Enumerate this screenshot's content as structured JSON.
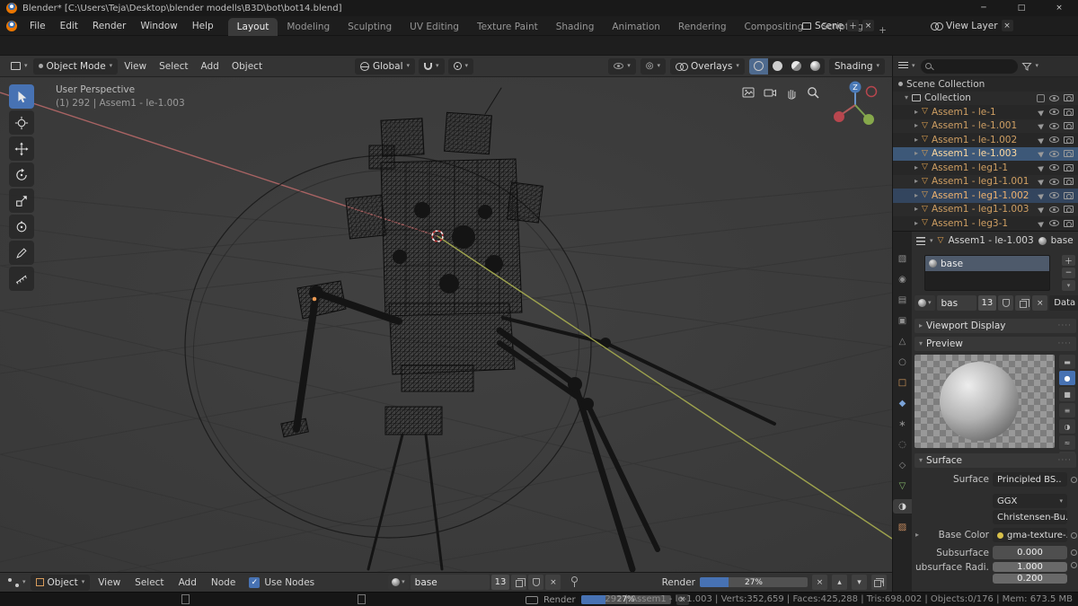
{
  "window": {
    "title": "Blender* [C:\\Users\\Teja\\Desktop\\blender modells\\B3D\\bot\\bot14.blend]",
    "minimize": "─",
    "maximize": "□",
    "close": "×"
  },
  "colors": {
    "accent": "#4772b3",
    "selection_orange": "#e9a55b",
    "axis_x": "#b56868",
    "axis_y": "#a3a84e"
  },
  "topbar": {
    "menus": [
      "File",
      "Edit",
      "Render",
      "Window",
      "Help"
    ],
    "workspaces": [
      "Layout",
      "Modeling",
      "Sculpting",
      "UV Editing",
      "Texture Paint",
      "Shading",
      "Animation",
      "Rendering",
      "Compositing",
      "Scripting"
    ],
    "add_tab": "+",
    "scene_label": "Scene",
    "view_layer_label": "View Layer"
  },
  "viewport_header": {
    "mode": "Object Mode",
    "menus": [
      "View",
      "Select",
      "Add",
      "Object"
    ],
    "orientation": "Global",
    "overlays_label": "Overlays",
    "shading_label": "Shading"
  },
  "viewport": {
    "view_label": "User Perspective",
    "object_label": "(1) 292 | Assem1 - le-1.003"
  },
  "outliner": {
    "root_label": "Scene Collection",
    "collection_label": "Collection",
    "items": [
      "Assem1 - le-1",
      "Assem1 - le-1.001",
      "Assem1 - le-1.002",
      "Assem1 - le-1.003",
      "Assem1 - leg1-1",
      "Assem1 - leg1-1.001",
      "Assem1 - leg1-1.002",
      "Assem1 - leg1-1.003",
      "Assem1 - leg3-1"
    ]
  },
  "properties": {
    "breadcrumb_object": "Assem1 - le-1.003",
    "breadcrumb_material": "base",
    "slot_name": "base",
    "datablock": {
      "name": "bas",
      "users": "13",
      "link": "Data"
    },
    "panels": {
      "viewport_display": "Viewport Display",
      "preview": "Preview",
      "surface": "Surface"
    },
    "surface": {
      "surface_label": "Surface",
      "shader": "Principled BS..",
      "distribution": "GGX",
      "subsurface_method": "Christensen-Bu..",
      "base_color_label": "Base Color",
      "base_color_value": "gma-texture-...",
      "subsurface_label": "Subsurface",
      "subsurface_value": "0.000",
      "radius_label": "ubsurface Radi..",
      "radius_value_1": "1.000",
      "radius_value_2": "0.200"
    }
  },
  "shader_editor": {
    "type_label": "Object",
    "menus": [
      "View",
      "Select",
      "Add",
      "Node"
    ],
    "use_nodes_label": "Use Nodes",
    "material_name": "base",
    "users": "13",
    "render_label": "Render",
    "render_percent": "27%"
  },
  "status_bar": {
    "render_label": "Render",
    "render_percent": "27%",
    "stats": "292 | Assem1 - le-1.003 | Verts:352,659 | Faces:425,288 | Tris:698,002 | Objects:0/176 | Mem: 673.5 MB"
  }
}
